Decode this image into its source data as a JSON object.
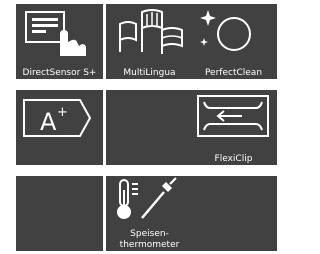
{
  "tiles": [
    {
      "id": "direct-sensor",
      "label": "DirectSensor S+",
      "icon": "touch-screen-hand-icon"
    },
    {
      "id": "multilingua",
      "label": "MultiLingua",
      "icon": "flags-icon"
    },
    {
      "id": "perfectclean",
      "label": "PerfectClean",
      "icon": "sparkle-circle-icon"
    },
    {
      "id": "energy-label",
      "label": "",
      "icon": "energy-label-a-plus-icon"
    },
    {
      "id": "empty-1",
      "label": "",
      "icon": ""
    },
    {
      "id": "flexiclip",
      "label": "FlexiClip",
      "icon": "flexiclip-rail-icon"
    },
    {
      "id": "empty-2",
      "label": "",
      "icon": ""
    },
    {
      "id": "food-probe",
      "label_line1": "Speisen-",
      "label_line2": "thermometer",
      "icon": "food-probe-thermometer-icon"
    },
    {
      "id": "empty-3",
      "label": "",
      "icon": ""
    }
  ],
  "colors": {
    "tile_bg": "#414141",
    "text": "#ffffff",
    "background": "#ffffff"
  }
}
